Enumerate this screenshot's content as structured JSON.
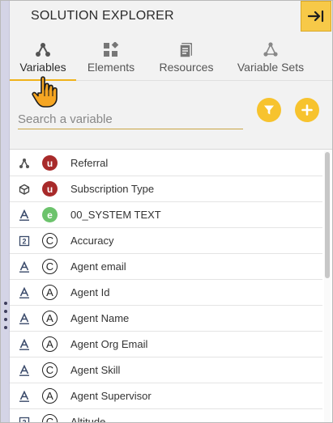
{
  "header": {
    "title": "SOLUTION EXPLORER",
    "collapse_icon": "arrow-right-to-bar-icon"
  },
  "tabs": [
    {
      "label": "Variables",
      "icon": "variables-node-icon",
      "active": true
    },
    {
      "label": "Elements",
      "icon": "elements-grid-icon",
      "active": false
    },
    {
      "label": "Resources",
      "icon": "resources-document-icon",
      "active": false
    },
    {
      "label": "Variable Sets",
      "icon": "variable-sets-icon",
      "active": false
    }
  ],
  "search": {
    "placeholder": "Search a variable",
    "value": ""
  },
  "actions": {
    "filter_icon": "filter-icon",
    "add_icon": "plus-icon"
  },
  "colors": {
    "accent": "#f7c32e",
    "badge_u": "#a82a2a",
    "badge_e": "#6cc36c"
  },
  "variables": [
    {
      "kind": "referral-node-icon",
      "badge": "u",
      "name": "Referral"
    },
    {
      "kind": "cube-icon",
      "badge": "u",
      "name": "Subscription Type"
    },
    {
      "kind": "text-type-icon",
      "badge": "e",
      "name": "00_SYSTEM TEXT"
    },
    {
      "kind": "number-type-icon",
      "badge": "C",
      "name": "Accuracy"
    },
    {
      "kind": "text-type-icon",
      "badge": "C",
      "name": "Agent email"
    },
    {
      "kind": "text-type-icon",
      "badge": "A",
      "name": "Agent Id"
    },
    {
      "kind": "text-type-icon",
      "badge": "A",
      "name": "Agent Name"
    },
    {
      "kind": "text-type-icon",
      "badge": "A",
      "name": "Agent Org Email"
    },
    {
      "kind": "text-type-icon",
      "badge": "C",
      "name": "Agent Skill"
    },
    {
      "kind": "text-type-icon",
      "badge": "A",
      "name": "Agent Supervisor"
    },
    {
      "kind": "number-type-icon",
      "badge": "C",
      "name": "Altitude"
    }
  ]
}
